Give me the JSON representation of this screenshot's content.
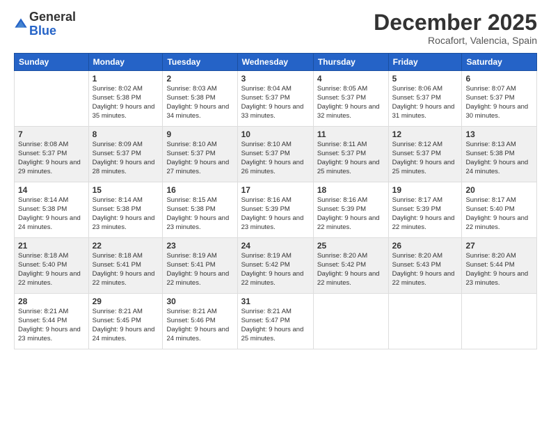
{
  "logo": {
    "general": "General",
    "blue": "Blue"
  },
  "header": {
    "month": "December 2025",
    "location": "Rocafort, Valencia, Spain"
  },
  "weekdays": [
    "Sunday",
    "Monday",
    "Tuesday",
    "Wednesday",
    "Thursday",
    "Friday",
    "Saturday"
  ],
  "weeks": [
    [
      {
        "day": "",
        "sunrise": "",
        "sunset": "",
        "daylight": ""
      },
      {
        "day": "1",
        "sunrise": "Sunrise: 8:02 AM",
        "sunset": "Sunset: 5:38 PM",
        "daylight": "Daylight: 9 hours and 35 minutes."
      },
      {
        "day": "2",
        "sunrise": "Sunrise: 8:03 AM",
        "sunset": "Sunset: 5:38 PM",
        "daylight": "Daylight: 9 hours and 34 minutes."
      },
      {
        "day": "3",
        "sunrise": "Sunrise: 8:04 AM",
        "sunset": "Sunset: 5:37 PM",
        "daylight": "Daylight: 9 hours and 33 minutes."
      },
      {
        "day": "4",
        "sunrise": "Sunrise: 8:05 AM",
        "sunset": "Sunset: 5:37 PM",
        "daylight": "Daylight: 9 hours and 32 minutes."
      },
      {
        "day": "5",
        "sunrise": "Sunrise: 8:06 AM",
        "sunset": "Sunset: 5:37 PM",
        "daylight": "Daylight: 9 hours and 31 minutes."
      },
      {
        "day": "6",
        "sunrise": "Sunrise: 8:07 AM",
        "sunset": "Sunset: 5:37 PM",
        "daylight": "Daylight: 9 hours and 30 minutes."
      }
    ],
    [
      {
        "day": "7",
        "sunrise": "Sunrise: 8:08 AM",
        "sunset": "Sunset: 5:37 PM",
        "daylight": "Daylight: 9 hours and 29 minutes."
      },
      {
        "day": "8",
        "sunrise": "Sunrise: 8:09 AM",
        "sunset": "Sunset: 5:37 PM",
        "daylight": "Daylight: 9 hours and 28 minutes."
      },
      {
        "day": "9",
        "sunrise": "Sunrise: 8:10 AM",
        "sunset": "Sunset: 5:37 PM",
        "daylight": "Daylight: 9 hours and 27 minutes."
      },
      {
        "day": "10",
        "sunrise": "Sunrise: 8:10 AM",
        "sunset": "Sunset: 5:37 PM",
        "daylight": "Daylight: 9 hours and 26 minutes."
      },
      {
        "day": "11",
        "sunrise": "Sunrise: 8:11 AM",
        "sunset": "Sunset: 5:37 PM",
        "daylight": "Daylight: 9 hours and 25 minutes."
      },
      {
        "day": "12",
        "sunrise": "Sunrise: 8:12 AM",
        "sunset": "Sunset: 5:37 PM",
        "daylight": "Daylight: 9 hours and 25 minutes."
      },
      {
        "day": "13",
        "sunrise": "Sunrise: 8:13 AM",
        "sunset": "Sunset: 5:38 PM",
        "daylight": "Daylight: 9 hours and 24 minutes."
      }
    ],
    [
      {
        "day": "14",
        "sunrise": "Sunrise: 8:14 AM",
        "sunset": "Sunset: 5:38 PM",
        "daylight": "Daylight: 9 hours and 24 minutes."
      },
      {
        "day": "15",
        "sunrise": "Sunrise: 8:14 AM",
        "sunset": "Sunset: 5:38 PM",
        "daylight": "Daylight: 9 hours and 23 minutes."
      },
      {
        "day": "16",
        "sunrise": "Sunrise: 8:15 AM",
        "sunset": "Sunset: 5:38 PM",
        "daylight": "Daylight: 9 hours and 23 minutes."
      },
      {
        "day": "17",
        "sunrise": "Sunrise: 8:16 AM",
        "sunset": "Sunset: 5:39 PM",
        "daylight": "Daylight: 9 hours and 23 minutes."
      },
      {
        "day": "18",
        "sunrise": "Sunrise: 8:16 AM",
        "sunset": "Sunset: 5:39 PM",
        "daylight": "Daylight: 9 hours and 22 minutes."
      },
      {
        "day": "19",
        "sunrise": "Sunrise: 8:17 AM",
        "sunset": "Sunset: 5:39 PM",
        "daylight": "Daylight: 9 hours and 22 minutes."
      },
      {
        "day": "20",
        "sunrise": "Sunrise: 8:17 AM",
        "sunset": "Sunset: 5:40 PM",
        "daylight": "Daylight: 9 hours and 22 minutes."
      }
    ],
    [
      {
        "day": "21",
        "sunrise": "Sunrise: 8:18 AM",
        "sunset": "Sunset: 5:40 PM",
        "daylight": "Daylight: 9 hours and 22 minutes."
      },
      {
        "day": "22",
        "sunrise": "Sunrise: 8:18 AM",
        "sunset": "Sunset: 5:41 PM",
        "daylight": "Daylight: 9 hours and 22 minutes."
      },
      {
        "day": "23",
        "sunrise": "Sunrise: 8:19 AM",
        "sunset": "Sunset: 5:41 PM",
        "daylight": "Daylight: 9 hours and 22 minutes."
      },
      {
        "day": "24",
        "sunrise": "Sunrise: 8:19 AM",
        "sunset": "Sunset: 5:42 PM",
        "daylight": "Daylight: 9 hours and 22 minutes."
      },
      {
        "day": "25",
        "sunrise": "Sunrise: 8:20 AM",
        "sunset": "Sunset: 5:42 PM",
        "daylight": "Daylight: 9 hours and 22 minutes."
      },
      {
        "day": "26",
        "sunrise": "Sunrise: 8:20 AM",
        "sunset": "Sunset: 5:43 PM",
        "daylight": "Daylight: 9 hours and 22 minutes."
      },
      {
        "day": "27",
        "sunrise": "Sunrise: 8:20 AM",
        "sunset": "Sunset: 5:44 PM",
        "daylight": "Daylight: 9 hours and 23 minutes."
      }
    ],
    [
      {
        "day": "28",
        "sunrise": "Sunrise: 8:21 AM",
        "sunset": "Sunset: 5:44 PM",
        "daylight": "Daylight: 9 hours and 23 minutes."
      },
      {
        "day": "29",
        "sunrise": "Sunrise: 8:21 AM",
        "sunset": "Sunset: 5:45 PM",
        "daylight": "Daylight: 9 hours and 24 minutes."
      },
      {
        "day": "30",
        "sunrise": "Sunrise: 8:21 AM",
        "sunset": "Sunset: 5:46 PM",
        "daylight": "Daylight: 9 hours and 24 minutes."
      },
      {
        "day": "31",
        "sunrise": "Sunrise: 8:21 AM",
        "sunset": "Sunset: 5:47 PM",
        "daylight": "Daylight: 9 hours and 25 minutes."
      },
      {
        "day": "",
        "sunrise": "",
        "sunset": "",
        "daylight": ""
      },
      {
        "day": "",
        "sunrise": "",
        "sunset": "",
        "daylight": ""
      },
      {
        "day": "",
        "sunrise": "",
        "sunset": "",
        "daylight": ""
      }
    ]
  ]
}
